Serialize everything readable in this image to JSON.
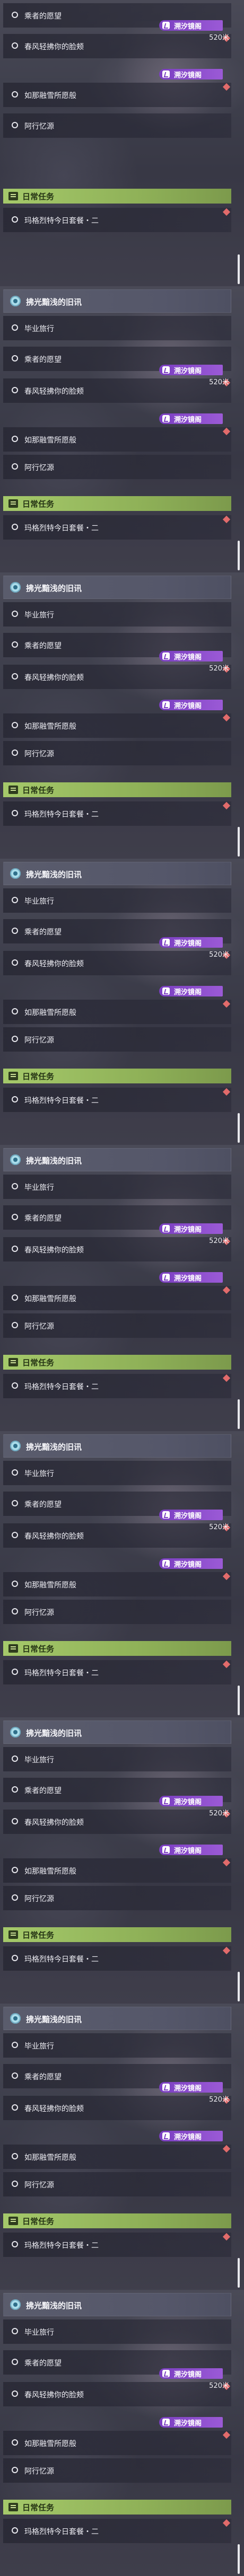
{
  "main_quest": {
    "title": "拂光黯浅的旧讯",
    "objectives": [
      "毕业旅行",
      "乘者的愿望",
      "春风轻拂你的脸颊",
      "如那融雪所愿般",
      "阿行忆源"
    ],
    "badge": {
      "label": "溯汐镜阁",
      "color": "#8a4bd0"
    },
    "distance": "520米"
  },
  "daily": {
    "title": "日常任务",
    "objective": "玛格烈特今日套餐・二"
  },
  "panels": [
    {
      "first_objective_shown": false,
      "visible_objectives": [
        2,
        3,
        4
      ]
    },
    {
      "first_objective_shown": true
    },
    {
      "first_objective_shown": true
    },
    {
      "first_objective_shown": true
    },
    {
      "first_objective_shown": true
    },
    {
      "first_objective_shown": true
    },
    {
      "first_objective_shown": true
    },
    {
      "first_objective_shown": true
    },
    {
      "first_objective_shown": true
    }
  ],
  "colors": {
    "quest_icon": "#a9dcea",
    "badge": "#8a4bd0",
    "daily_header": "#a5c96a",
    "objective_marker": "#e26b6b"
  }
}
